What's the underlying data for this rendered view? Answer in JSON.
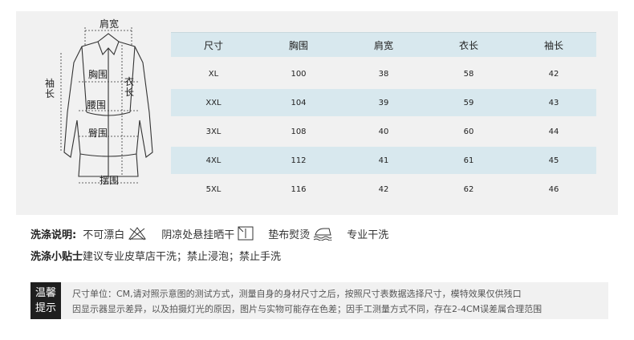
{
  "diagram": {
    "shoulder": "肩宽",
    "chest": "胸围",
    "waist": "腰围",
    "hip": "臀围",
    "hem": "摆围",
    "sleeve": "袖长",
    "length": "衣长"
  },
  "table": {
    "headers": [
      "尺寸",
      "胸围",
      "肩宽",
      "衣长",
      "袖长"
    ],
    "rows": [
      [
        "XL",
        "100",
        "38",
        "58",
        "42"
      ],
      [
        "XXL",
        "104",
        "39",
        "59",
        "43"
      ],
      [
        "3XL",
        "108",
        "40",
        "60",
        "44"
      ],
      [
        "4XL",
        "112",
        "41",
        "61",
        "45"
      ],
      [
        "5XL",
        "116",
        "42",
        "62",
        "46"
      ]
    ]
  },
  "care": {
    "label": "洗涤说明:",
    "items": [
      "不可漂白",
      "阴凉处悬挂晒干",
      "垫布熨烫",
      "专业干洗"
    ]
  },
  "tips": {
    "label": "洗涤小贴士",
    "text": "建议专业皮草店干洗；禁止浸泡；禁止手洗"
  },
  "notice": {
    "badge_top": "温馨",
    "badge_bottom": "提示",
    "line1": "尺寸单位：CM,请对照示意图的测试方式，测量自身的身材尺寸之后，按照尺寸表数据选择尺寸，模特效果仅供残口",
    "line2": "因显示器显示差异，以及拍摄灯光的原因，图片与实物可能存在色差；因手工测量方式不同，存在2-4CM误差属合理范围"
  }
}
